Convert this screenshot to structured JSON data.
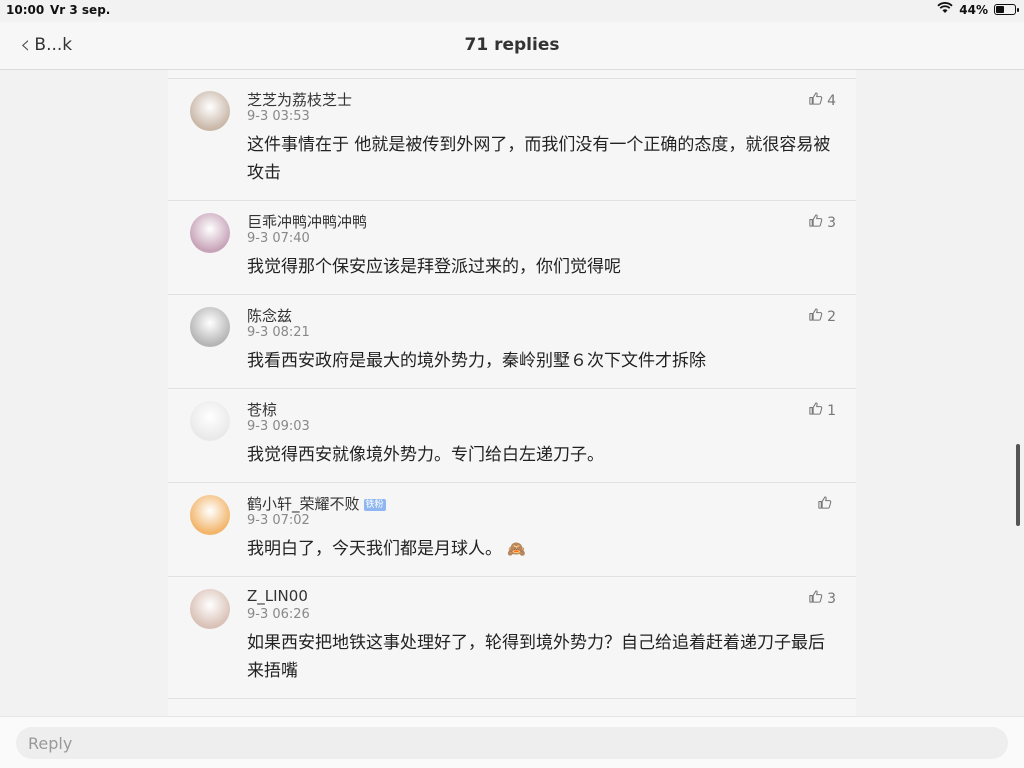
{
  "status_bar": {
    "time": "10:00",
    "date": "Vr 3 sep.",
    "battery": "44%",
    "battery_level": 0.44
  },
  "nav": {
    "back_label": "B...k",
    "title": "71 replies"
  },
  "comments": [
    {
      "user": "芝芝为荔枝芝士",
      "time": "9-3 03:53",
      "likes": "4",
      "text": "这件事情在于 他就是被传到外网了，而我们没有一个正确的态度，就很容易被攻击",
      "avatar_color": "#c9b7a8"
    },
    {
      "user": "巨乖冲鸭冲鸭冲鸭",
      "time": "9-3 07:40",
      "likes": "3",
      "text": "我觉得那个保安应该是拜登派过来的，你们觉得呢",
      "avatar_color": "#c7a3b8"
    },
    {
      "user": "陈念兹",
      "time": "9-3 08:21",
      "likes": "2",
      "text": "我看西安政府是最大的境外势力，秦岭别墅６次下文件才拆除",
      "avatar_color": "#b5b5b5"
    },
    {
      "user": "苍椋",
      "time": "9-3 09:03",
      "likes": "1",
      "text": "我觉得西安就像境外势力。专门给白左递刀子。",
      "avatar_color": "#e9e9e9"
    },
    {
      "user": "鹤小轩_荣耀不败",
      "badge": "铁粉",
      "time": "9-3 07:02",
      "likes": "",
      "text": "我明白了，今天我们都是月球人。",
      "emoji": "🙈",
      "avatar_color": "#f2b56a"
    },
    {
      "user": "Z_LIN00",
      "time": "9-3 06:26",
      "likes": "3",
      "text": "如果西安把地铁这事处理好了，轮得到境外势力？自己给追着赶着递刀子最后来捂嘴",
      "avatar_color": "#d9c1b6"
    }
  ],
  "reply": {
    "placeholder": "Reply"
  }
}
